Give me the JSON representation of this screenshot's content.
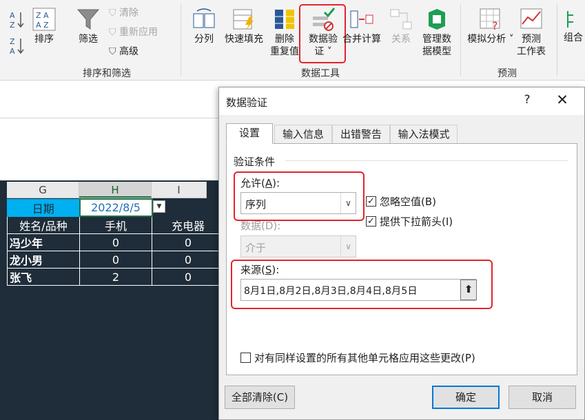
{
  "ribbon": {
    "sort_asc_icon": "sort-a-to-z-icon",
    "sort_desc_icon": "sort-z-to-a-icon",
    "sort_label": "排序",
    "filter_label": "筛选",
    "clear_label": "清除",
    "reapply_label": "重新应用",
    "advanced_label": "高级",
    "group_sort_filter": "排序和筛选",
    "split_label": "分列",
    "flashfill_label": "快速填充",
    "dedupe_line1": "删除",
    "dedupe_line2": "重复值",
    "validation_line1": "数据验",
    "validation_line2": "证 ˅",
    "consolidate_label": "合并计算",
    "relations_label": "关系",
    "datamodel_line1": "管理数",
    "datamodel_line2": "据模型",
    "group_data_tools": "数据工具",
    "whatif_label": "模拟分析 ˅",
    "forecast_line1": "预测",
    "forecast_line2": "工作表",
    "group_forecast": "预测",
    "group_outline": "组合"
  },
  "sheet": {
    "columns": [
      "G",
      "H",
      "I"
    ],
    "header_row": {
      "label": "日期",
      "value": "2022/8/5"
    },
    "sub_header": [
      "姓名/品种",
      "手机",
      "充电器"
    ],
    "rows": [
      {
        "name": "冯少年",
        "phone": "0",
        "charger": "0"
      },
      {
        "name": "龙小男",
        "phone": "0",
        "charger": "0"
      },
      {
        "name": "张飞",
        "phone": "2",
        "charger": "0"
      }
    ]
  },
  "dialog": {
    "title": "数据验证",
    "help": "?",
    "close": "✕",
    "tabs": [
      "设置",
      "输入信息",
      "出错警告",
      "输入法模式"
    ],
    "section": "验证条件",
    "allow_label": "允许(A):",
    "allow_value": "序列",
    "data_label": "数据(D):",
    "data_value": "介于",
    "ignore_blank": "忽略空值(B)",
    "dropdown_arrow": "提供下拉箭头(I)",
    "source_label": "来源(S):",
    "source_value": "8月1日,8月2日,8月3日,8月4日,8月5日",
    "apply_all": "对有同样设置的所有其他单元格应用这些更改(P)",
    "clear_all": "全部清除(C)",
    "ok": "确定",
    "cancel": "取消"
  },
  "colors": {
    "accent_red": "#e4232b",
    "sheet_dark": "#1f2d3a",
    "header_cyan": "#00b0f0",
    "excel_green": "#217346"
  }
}
